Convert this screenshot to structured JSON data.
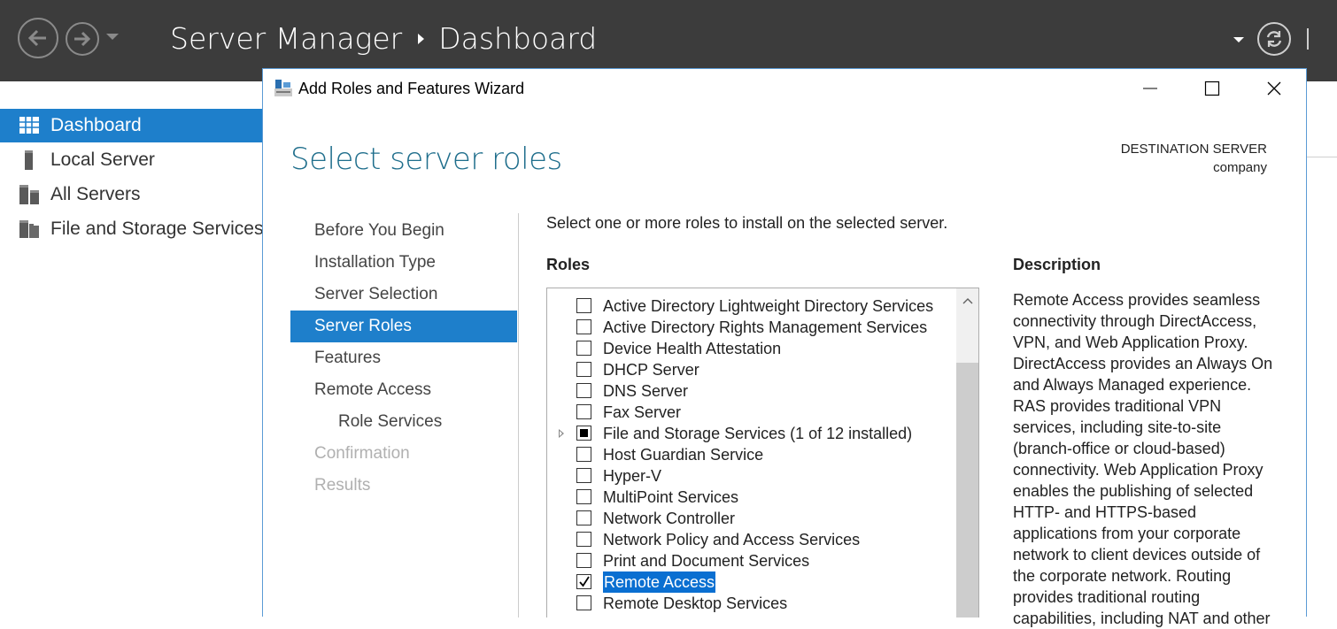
{
  "server_manager": {
    "title": "Server Manager",
    "page": "Dashboard",
    "sidebar": [
      {
        "label": "Dashboard",
        "icon": "dashboard-grid-icon",
        "active": true
      },
      {
        "label": "Local Server",
        "icon": "server-tower-icon",
        "active": false
      },
      {
        "label": "All Servers",
        "icon": "servers-icon",
        "active": false
      },
      {
        "label": "File and Storage Services",
        "icon": "folder-storage-icon",
        "active": false
      }
    ]
  },
  "wizard": {
    "window_title": "Add Roles and Features Wizard",
    "heading": "Select server roles",
    "destination_label": "DESTINATION SERVER",
    "destination_value": "company",
    "nav": [
      {
        "label": "Before You Begin",
        "state": "normal"
      },
      {
        "label": "Installation Type",
        "state": "normal"
      },
      {
        "label": "Server Selection",
        "state": "normal"
      },
      {
        "label": "Server Roles",
        "state": "active"
      },
      {
        "label": "Features",
        "state": "normal"
      },
      {
        "label": "Remote Access",
        "state": "normal"
      },
      {
        "label": "Role Services",
        "state": "sub"
      },
      {
        "label": "Confirmation",
        "state": "disabled"
      },
      {
        "label": "Results",
        "state": "disabled"
      }
    ],
    "instruction": "Select one or more roles to install on the selected server.",
    "roles_heading": "Roles",
    "description_heading": "Description",
    "roles": [
      {
        "label": "Active Directory Lightweight Directory Services",
        "state": "unchecked"
      },
      {
        "label": "Active Directory Rights Management Services",
        "state": "unchecked"
      },
      {
        "label": "Device Health Attestation",
        "state": "unchecked"
      },
      {
        "label": "DHCP Server",
        "state": "unchecked"
      },
      {
        "label": "DNS Server",
        "state": "unchecked"
      },
      {
        "label": "Fax Server",
        "state": "unchecked"
      },
      {
        "label": "File and Storage Services (1 of 12 installed)",
        "state": "partial",
        "expandable": true
      },
      {
        "label": "Host Guardian Service",
        "state": "unchecked"
      },
      {
        "label": "Hyper-V",
        "state": "unchecked"
      },
      {
        "label": "MultiPoint Services",
        "state": "unchecked"
      },
      {
        "label": "Network Controller",
        "state": "unchecked"
      },
      {
        "label": "Network Policy and Access Services",
        "state": "unchecked"
      },
      {
        "label": "Print and Document Services",
        "state": "unchecked"
      },
      {
        "label": "Remote Access",
        "state": "checked",
        "selected": true
      },
      {
        "label": "Remote Desktop Services",
        "state": "unchecked"
      }
    ],
    "description": "Remote Access provides seamless connectivity through DirectAccess, VPN, and Web Application Proxy. DirectAccess provides an Always On and Always Managed experience. RAS provides traditional VPN services, including site-to-site (branch-office or cloud-based) connectivity. Web Application Proxy enables the publishing of selected HTTP- and HTTPS-based applications from your corporate network to client devices outside of the corporate network. Routing provides traditional routing capabilities, including NAT and other"
  }
}
